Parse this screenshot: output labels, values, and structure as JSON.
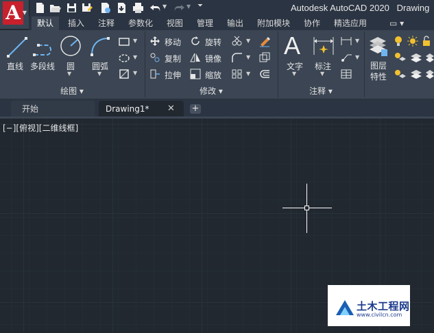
{
  "title_bar": {
    "app_name": "Autodesk AutoCAD 2020",
    "document": "Drawing",
    "logo_letter": "A",
    "quick_access_icons": [
      "new-icon",
      "open-icon",
      "save-icon",
      "save-as-icon",
      "open-web-icon",
      "save-web-icon",
      "plot-icon",
      "undo-icon",
      "redo-icon",
      "customize-dropdown-icon"
    ]
  },
  "ribbon_tabs": [
    "默认",
    "插入",
    "注释",
    "参数化",
    "视图",
    "管理",
    "输出",
    "附加模块",
    "协作",
    "精选应用"
  ],
  "ribbon_active_tab": "默认",
  "ribbon_extra": "▭ ▾",
  "panels": {
    "draw": {
      "title": "绘图 ▾",
      "line": "直线",
      "polyline": "多段线",
      "circle": "圆",
      "arc": "圆弧"
    },
    "modify": {
      "title": "修改 ▾",
      "move": "移动",
      "rotate": "旋转",
      "copy": "复制",
      "mirror": "镜像",
      "stretch": "拉伸",
      "scale": "缩放"
    },
    "annotation": {
      "title": "注释 ▾",
      "text": "文字",
      "dimension": "标注"
    },
    "layers": {
      "title": "图层\n特性",
      "line1": "图层",
      "line2": "特性"
    }
  },
  "doc_tabs": {
    "start": "开始",
    "drawing": "Drawing1*",
    "close": "✕",
    "add": "+"
  },
  "canvas": {
    "viewport_label": "[−][俯视][二维线框]"
  },
  "watermark": {
    "name": "土木工程网",
    "url": "www.civilcn.com"
  },
  "colors": {
    "title_bg": "#2b3442",
    "ribbon_bg": "#3b4553",
    "canvas_bg": "#212830",
    "accent_red": "#c8202c",
    "icon_blue": "#6fb4f0",
    "icon_yellow": "#f2c030"
  }
}
